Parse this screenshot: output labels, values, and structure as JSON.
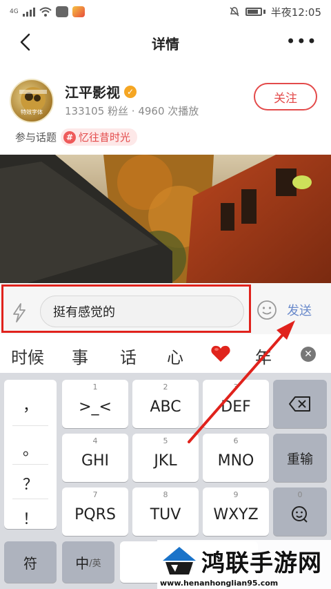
{
  "status_bar": {
    "network": "4G",
    "time": "半夜12:05"
  },
  "nav": {
    "title": "详情",
    "more_label": "•••"
  },
  "profile": {
    "name": "江平影视",
    "stats": "133105 粉丝 · 4960 次播放",
    "follow_label": "关注",
    "verified_mark": "✓",
    "avatar_text": "特效字体"
  },
  "topic": {
    "label": "参与话题",
    "hash": "#",
    "name": "忆往昔时光"
  },
  "comment": {
    "input_text": "挺有感觉的",
    "send_label": "发送"
  },
  "suggestions": [
    "时候",
    "事",
    "话",
    "心",
    "年"
  ],
  "keyboard": {
    "punctuation": [
      "，",
      "。",
      "？",
      "！"
    ],
    "keys": [
      {
        "num": "1",
        "label": ">_<"
      },
      {
        "num": "2",
        "label": "ABC"
      },
      {
        "num": "3",
        "label": "DEF"
      },
      {
        "num": "4",
        "label": "GHI"
      },
      {
        "num": "5",
        "label": "JKL"
      },
      {
        "num": "6",
        "label": "MNO"
      },
      {
        "num": "7",
        "label": "PQRS"
      },
      {
        "num": "8",
        "label": "TUV"
      },
      {
        "num": "9",
        "label": "WXYZ"
      }
    ],
    "backspace_icon": "backspace-icon",
    "reinput_label": "重输",
    "emoji_num": "0",
    "symbol_label": "符",
    "lang_main": "中",
    "lang_sub": "/英",
    "space_label": "␣"
  },
  "watermark": {
    "title": "鸿联手游网",
    "url": "www.henanhonglian95.com"
  },
  "colors": {
    "accent_red": "#e34a4a",
    "highlight_red": "#e0221c",
    "send_blue": "#6a8acb"
  }
}
